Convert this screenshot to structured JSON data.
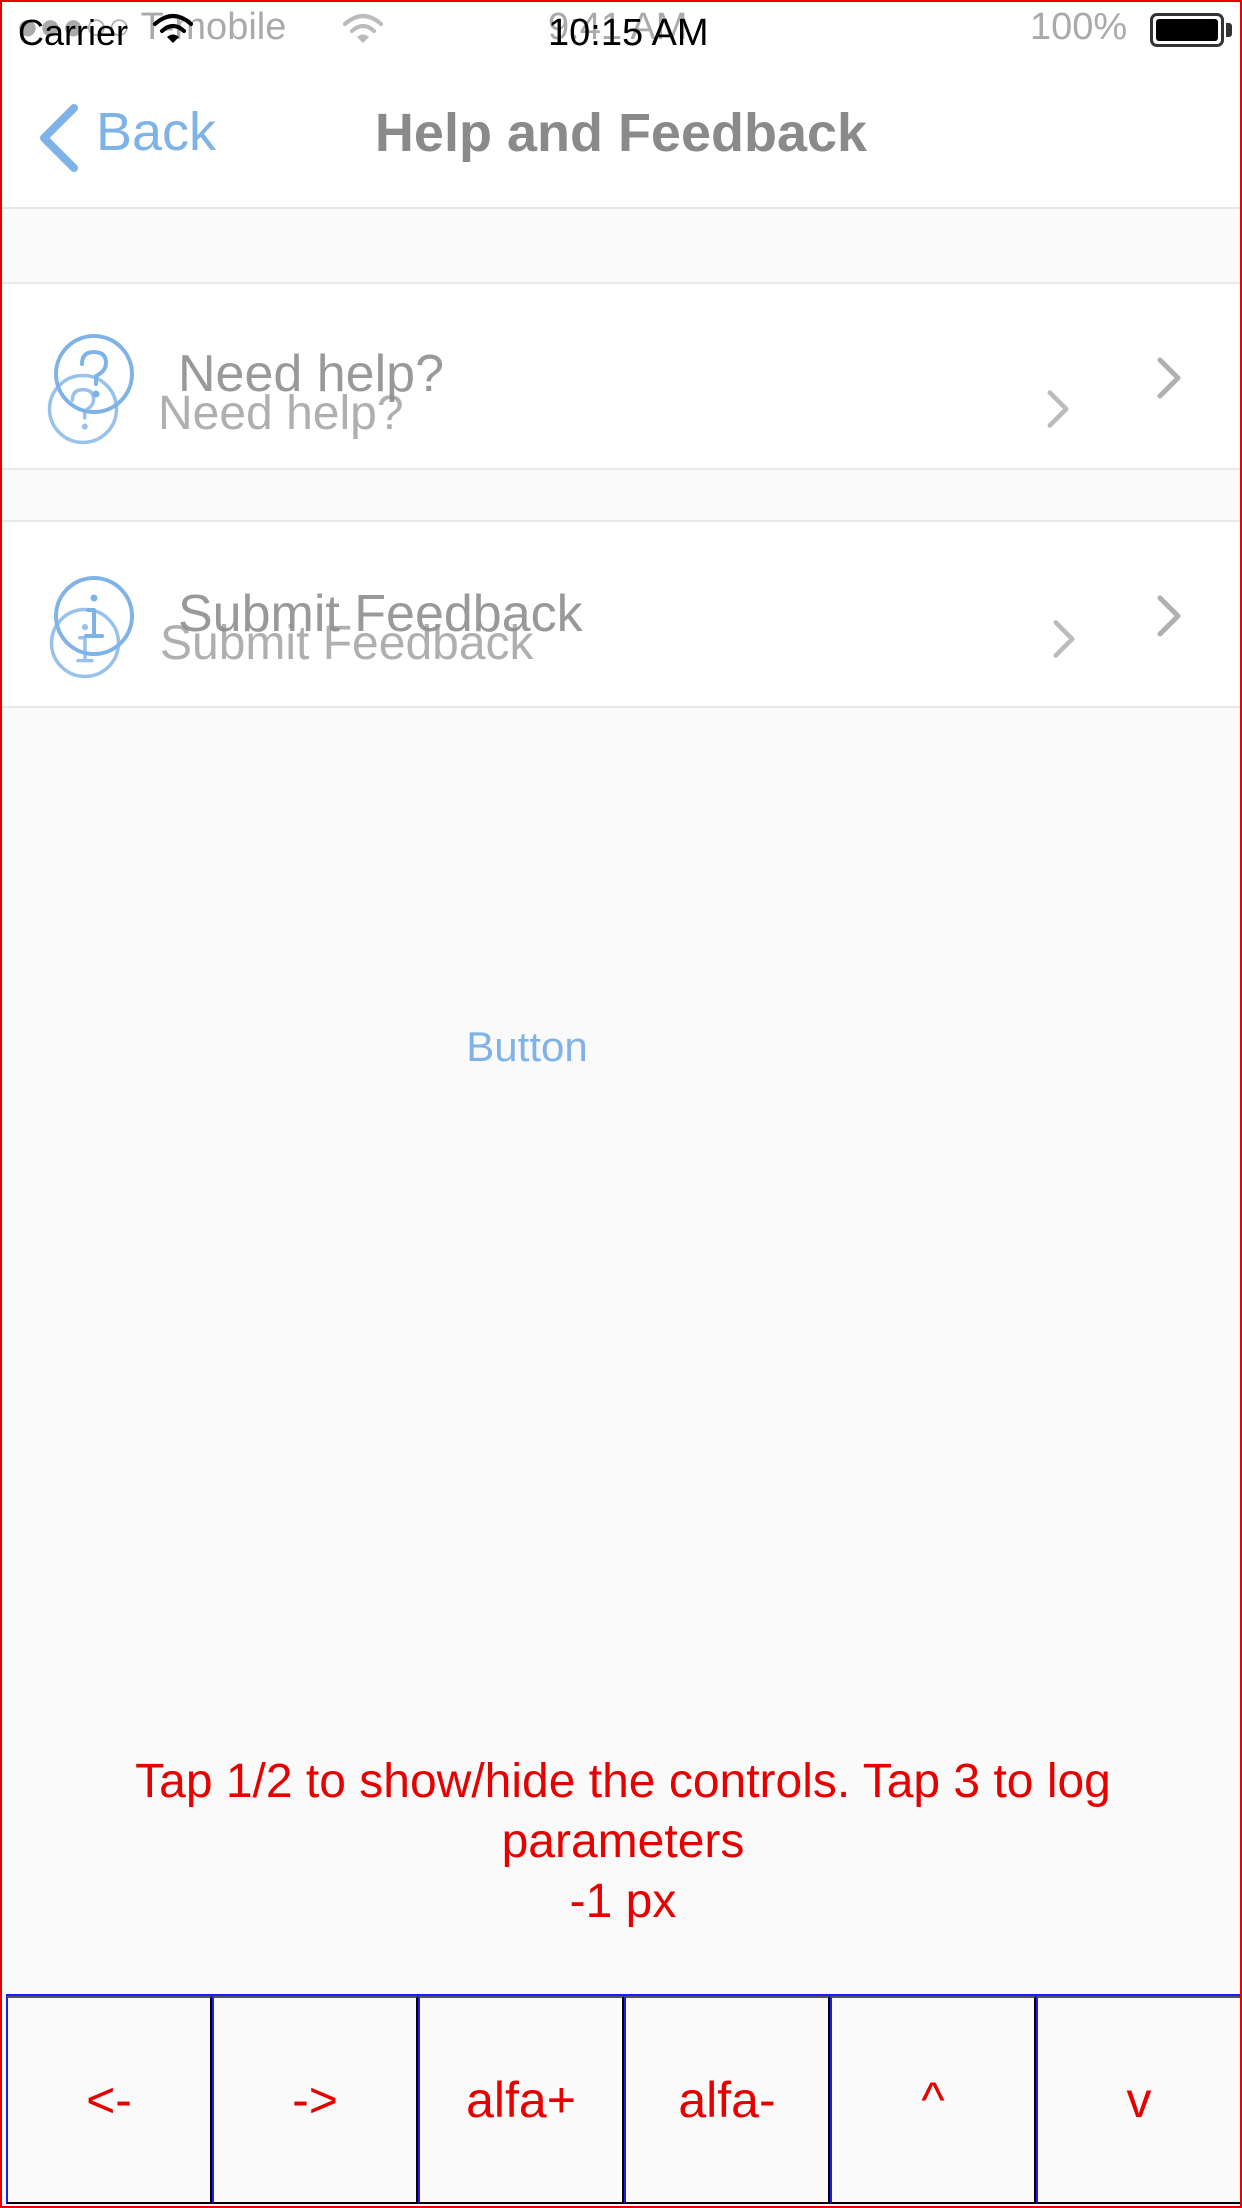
{
  "status_bar": {
    "ghost_carrier": "●●●○○ T-mobile",
    "carrier": "Carrier",
    "ghost_time": "9:41 AM",
    "time": "10:15 AM",
    "battery": "100%"
  },
  "nav": {
    "back_label": "Back",
    "title": "Help and Feedback"
  },
  "rows": [
    {
      "label": "Need help?",
      "icon": "question-circle-icon"
    },
    {
      "label": "Submit Feedback",
      "icon": "info-circle-icon"
    }
  ],
  "center_button": "Button",
  "info": {
    "line1": "Tap 1/2 to show/hide the controls. Tap 3 to log",
    "line2": "parameters",
    "line3": "-1 px"
  },
  "controls": [
    "<-",
    "->",
    "alfa+",
    "alfa-",
    "^",
    "v"
  ],
  "colors": {
    "accent": "#7fb3e8",
    "debug_red": "#e60000",
    "debug_blue": "#1a1aff",
    "label_gray": "#8e8e8e"
  }
}
